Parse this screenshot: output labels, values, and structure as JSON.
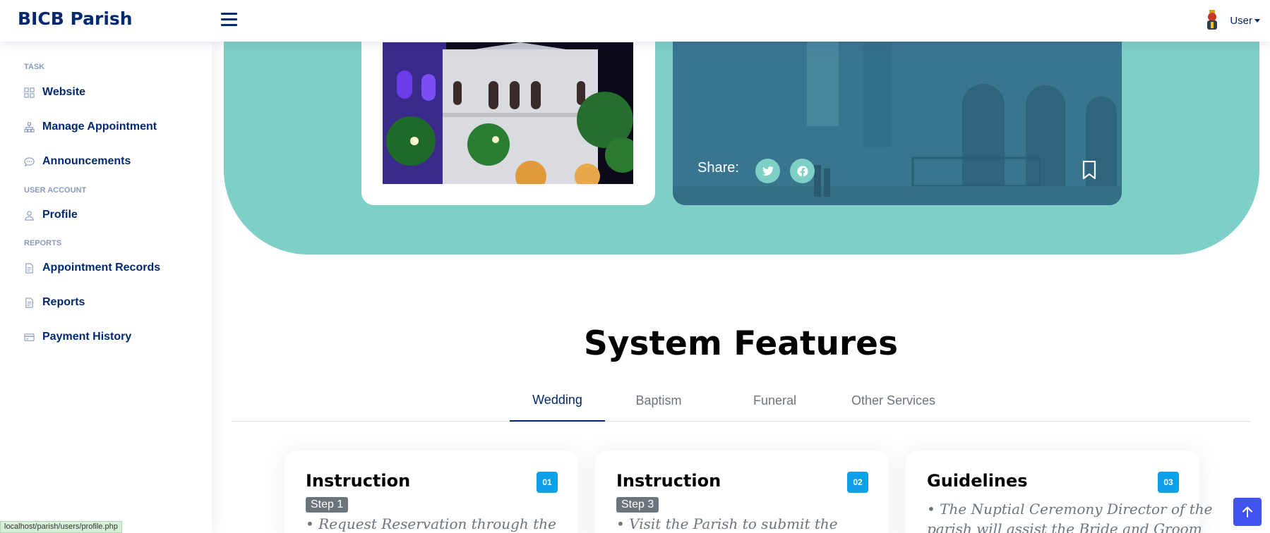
{
  "header": {
    "brand": "BICB Parish",
    "user_label": "User"
  },
  "sidebar": {
    "headings": [
      "TASK",
      "USER ACCOUNT",
      "REPORTS"
    ],
    "items": [
      {
        "label": "Website",
        "icon": "grid-icon"
      },
      {
        "label": "Manage Appointment",
        "icon": "diagram-icon"
      },
      {
        "label": "Announcements",
        "icon": "chat-icon"
      },
      {
        "label": "Profile",
        "icon": "person-icon"
      },
      {
        "label": "Appointment Records",
        "icon": "file-icon"
      },
      {
        "label": "Reports",
        "icon": "file-icon"
      },
      {
        "label": "Payment History",
        "icon": "credit-card-icon"
      }
    ]
  },
  "hero": {
    "share_label": "Share:"
  },
  "features": {
    "title": "System Features",
    "tabs": [
      "Wedding",
      "Baptism",
      "Funeral",
      "Other Services"
    ],
    "active_tab": "Wedding",
    "cards": [
      {
        "title": "Instruction",
        "number": "01",
        "step": "Step 1",
        "text": "• Request Reservation through the"
      },
      {
        "title": "Instruction",
        "number": "02",
        "step": "Step 3",
        "text": "• Visit the Parish to submit the"
      },
      {
        "title": "Guidelines",
        "number": "03",
        "step": "",
        "text": "• The Nuptial Ceremony Director of the",
        "text2": "parish will assist the Bride and Groom"
      }
    ]
  },
  "status_bar": {
    "url": "localhost/parish/users/profile.php"
  },
  "colors": {
    "brand": "#012970",
    "hero_bg": "#7ecfc5",
    "badge_blue": "#0d9ee8",
    "back_to_top": "#4154f1"
  }
}
